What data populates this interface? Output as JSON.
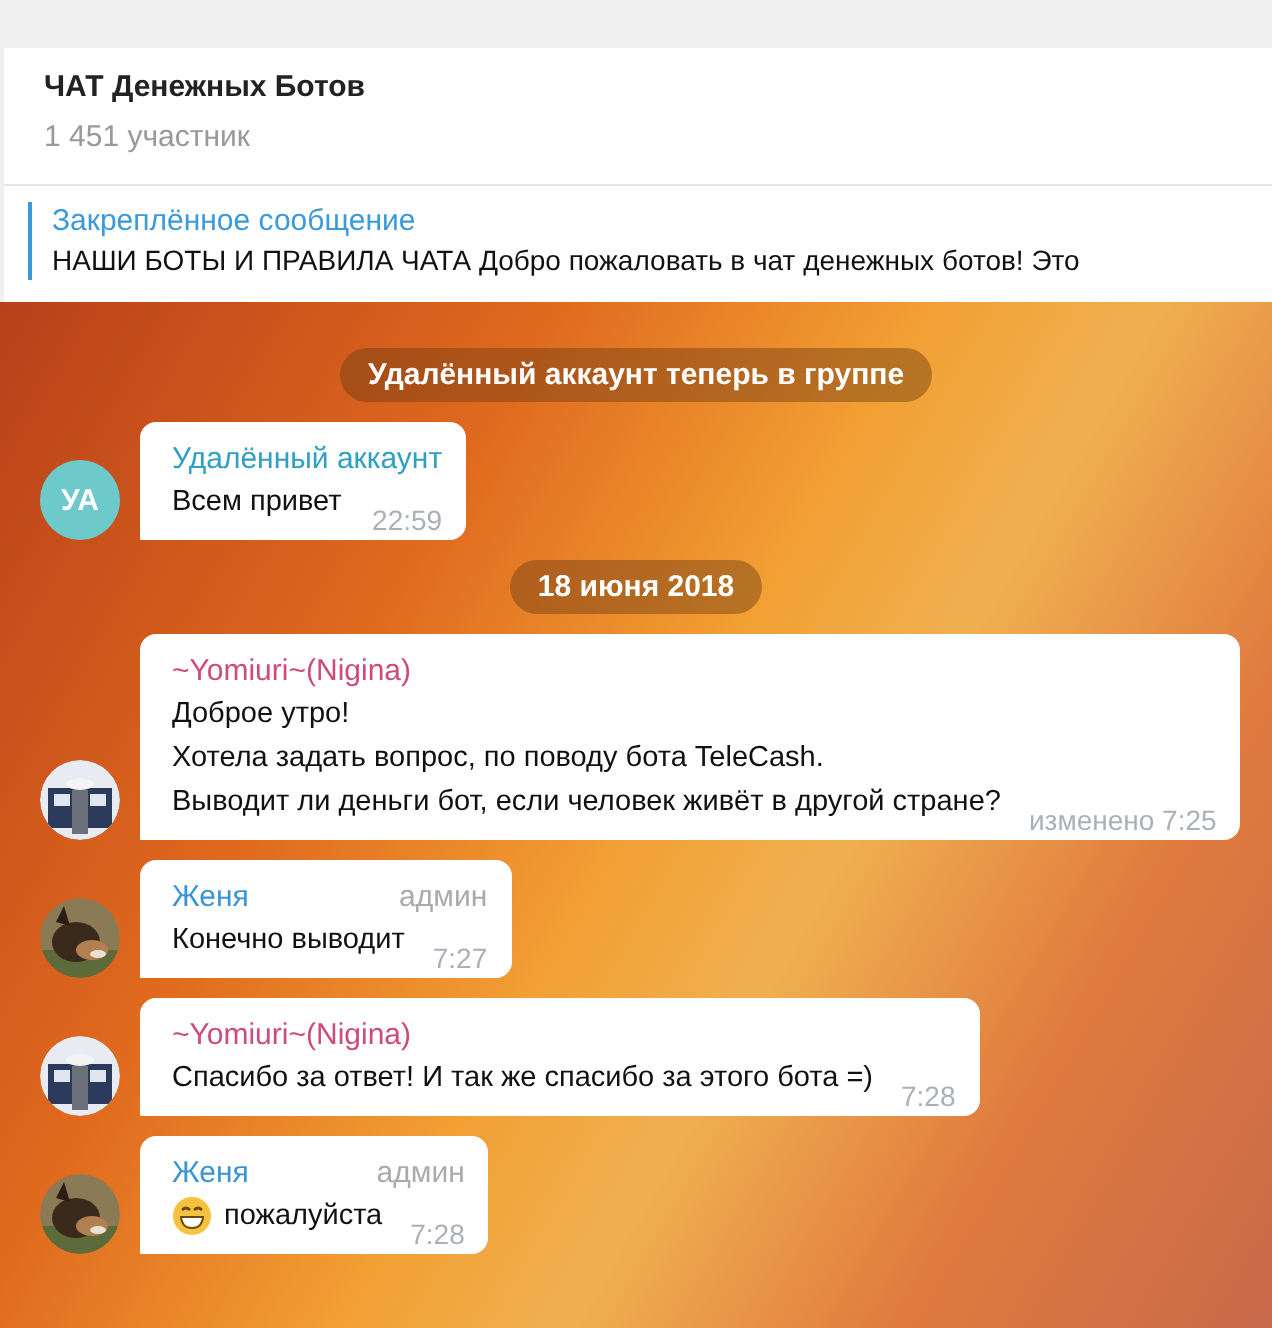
{
  "header": {
    "title": "ЧАТ Денежных Ботов",
    "subtitle": "1 451 участник"
  },
  "pinned": {
    "label": "Закреплённое сообщение",
    "text": "НАШИ БОТЫ И ПРАВИЛА ЧАТА  Добро пожаловать в чат денежных ботов! Это"
  },
  "messages": [
    {
      "kind": "service",
      "text": "Удалённый аккаунт теперь в группе"
    },
    {
      "kind": "message",
      "avatar": {
        "kind": "initials",
        "initials": "УА",
        "color": "#6ec9cb"
      },
      "sender": "Удалённый аккаунт",
      "color": "#2f9fc4",
      "lines": [
        "Всем привет"
      ],
      "time": "22:59"
    },
    {
      "kind": "date",
      "text": "18 июня 2018"
    },
    {
      "kind": "message",
      "sender": "~Yomiuri~(Nigina)",
      "color": "#ce4b7d",
      "lines": [
        "Доброе утро!",
        "Хотела задать вопрос, по поводу бота TeleCash.",
        "Выводит ли деньги бот, если человек живёт в другой стране?"
      ],
      "edited": "изменено",
      "time": "7:25"
    },
    {
      "kind": "message",
      "sender": "Женя",
      "color": "#3a95d4",
      "badge": "админ",
      "lines": [
        "Конечно выводит"
      ],
      "time": "7:27"
    },
    {
      "kind": "message",
      "sender": "~Yomiuri~(Nigina)",
      "color": "#ce4b7d",
      "lines": [
        "Спасибо за ответ! И так же спасибо за этого бота =)"
      ],
      "time": "7:28"
    },
    {
      "kind": "message",
      "sender": "Женя",
      "color": "#3a95d4",
      "badge": "админ",
      "grin": true,
      "lines": [
        "пожалуйста"
      ],
      "time": "7:28"
    }
  ]
}
